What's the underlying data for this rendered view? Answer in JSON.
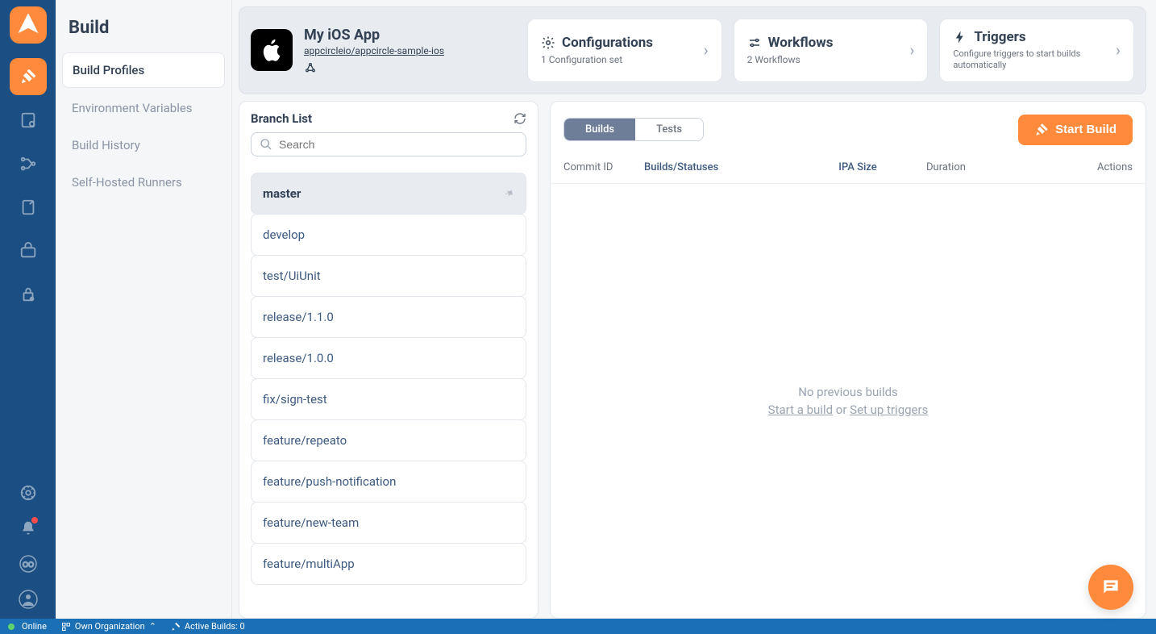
{
  "sidebar": {
    "title": "Build",
    "items": [
      {
        "label": "Build Profiles",
        "active": true
      },
      {
        "label": "Environment Variables",
        "active": false
      },
      {
        "label": "Build History",
        "active": false
      },
      {
        "label": "Self-Hosted Runners",
        "active": false
      }
    ]
  },
  "profile": {
    "app_name": "My iOS App",
    "repo": "appcircleio/appcircle-sample-ios",
    "cards": {
      "configurations": {
        "title": "Configurations",
        "sub": "1 Configuration set"
      },
      "workflows": {
        "title": "Workflows",
        "sub": "2 Workflows"
      },
      "triggers": {
        "title": "Triggers",
        "sub": "Configure triggers to start builds automatically"
      }
    }
  },
  "branch": {
    "title": "Branch List",
    "search_placeholder": "Search",
    "items": [
      {
        "name": "master",
        "active": true
      },
      {
        "name": "develop"
      },
      {
        "name": "test/UiUnit"
      },
      {
        "name": "release/1.1.0"
      },
      {
        "name": "release/1.0.0"
      },
      {
        "name": "fix/sign-test"
      },
      {
        "name": "feature/repeato"
      },
      {
        "name": "feature/push-notification"
      },
      {
        "name": "feature/new-team"
      },
      {
        "name": "feature/multiApp"
      }
    ]
  },
  "builds": {
    "tabs": {
      "builds": "Builds",
      "tests": "Tests"
    },
    "start_label": "Start Build",
    "columns": {
      "commit": "Commit ID",
      "status": "Builds/Statuses",
      "ipa": "IPA Size",
      "duration": "Duration",
      "actions": "Actions"
    },
    "empty": {
      "headline": "No previous builds",
      "start_link": "Start a build",
      "or": " or ",
      "triggers_link": "Set up triggers"
    }
  },
  "status": {
    "online": "Online",
    "org": "Own Organization",
    "active": "Active Builds: 0"
  }
}
